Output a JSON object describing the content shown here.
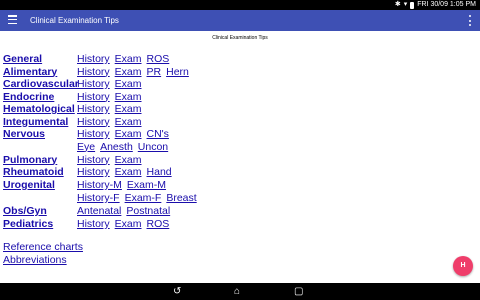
{
  "status_bar": {
    "datetime": "FRI 30/09 1:05 PM"
  },
  "app_bar": {
    "title": "Clinical Examination Tips",
    "menu_icon": "hamburger-menu-icon",
    "overflow_icon": "overflow-menu-icon"
  },
  "page_heading": "Clinical Examination Tips",
  "categories": [
    {
      "label": "General",
      "links": [
        "History",
        "Exam",
        "ROS"
      ]
    },
    {
      "label": "Alimentary",
      "links": [
        "History",
        "Exam",
        "PR",
        "Hern"
      ]
    },
    {
      "label": "Cardiovascular",
      "links": [
        "History",
        "Exam"
      ]
    },
    {
      "label": "Endocrine",
      "links": [
        "History",
        "Exam"
      ]
    },
    {
      "label": "Hematological",
      "links": [
        "History",
        "Exam"
      ]
    },
    {
      "label": "Integumental",
      "links": [
        "History",
        "Exam"
      ]
    },
    {
      "label": "Nervous",
      "links": [
        "History",
        "Exam",
        "CN's"
      ],
      "extra_links": [
        "Eye",
        "Anesth",
        "Uncon"
      ]
    },
    {
      "label": "Pulmonary",
      "links": [
        "History",
        "Exam"
      ]
    },
    {
      "label": "Rheumatoid",
      "links": [
        "History",
        "Exam",
        "Hand"
      ]
    },
    {
      "label": "Urogenital",
      "links": [
        "History-M",
        "Exam-M"
      ],
      "extra_links": [
        "History-F",
        "Exam-F",
        "Breast"
      ]
    },
    {
      "label": "Obs/Gyn",
      "links": [
        "Antenatal",
        "Postnatal"
      ]
    },
    {
      "label": "Pediatrics",
      "links": [
        "History",
        "Exam",
        "ROS"
      ]
    }
  ],
  "footer_links": [
    "Reference charts",
    "Abbreviations"
  ],
  "fab": {
    "label": "H",
    "color": "#ef3d6a"
  },
  "colors": {
    "app_bar": "#3e50b4",
    "link": "#1a0dab"
  },
  "nav_icons": [
    "back-icon",
    "home-icon",
    "recents-icon"
  ]
}
